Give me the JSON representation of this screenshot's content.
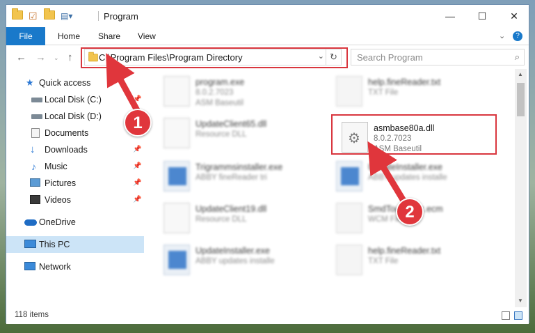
{
  "window": {
    "title": "Program",
    "controls": {
      "minimize": "—",
      "maximize": "☐",
      "close": "✕"
    }
  },
  "ribbon": {
    "tabs": [
      "File",
      "Home",
      "Share",
      "View"
    ],
    "expand_icon": "chevron-down",
    "help_icon": "?"
  },
  "address": {
    "path": "C:\\Program Files\\Program Directory",
    "search_placeholder": "Search Program"
  },
  "nav": {
    "items": [
      {
        "label": "Quick access",
        "icon": "star-icon",
        "pinned": false
      },
      {
        "label": "Local Disk (C:)",
        "icon": "drive-icon",
        "pinned": true
      },
      {
        "label": "Local Disk (D:)",
        "icon": "drive-icon",
        "pinned": false
      },
      {
        "label": "Documents",
        "icon": "documents-icon",
        "pinned": true
      },
      {
        "label": "Downloads",
        "icon": "download-icon",
        "pinned": true
      },
      {
        "label": "Music",
        "icon": "music-icon",
        "pinned": true
      },
      {
        "label": "Pictures",
        "icon": "pictures-icon",
        "pinned": true
      },
      {
        "label": "Videos",
        "icon": "videos-icon",
        "pinned": true
      },
      {
        "label": "OneDrive",
        "icon": "cloud-icon",
        "pinned": false
      },
      {
        "label": "This PC",
        "icon": "computer-icon",
        "pinned": false,
        "selected": true
      },
      {
        "label": "Network",
        "icon": "network-icon",
        "pinned": false
      }
    ]
  },
  "files": [
    {
      "name": "program.exe",
      "line1": "8.0.2.7023",
      "line2": "ASM Baseutil",
      "blurred": true
    },
    {
      "name": "help.fineReader.txt",
      "line1": "TXT File",
      "line2": "",
      "blurred": true
    },
    {
      "name": "UpdateClient65.dll",
      "line1": "Resource DLL",
      "line2": "",
      "blurred": true
    },
    {
      "name": "asmbase80a.dll",
      "line1": "8.0.2.7023",
      "line2": "ASM Baseutil",
      "blurred": false
    },
    {
      "name": "Trigrammsinstaller.exe",
      "line1": "ABBY fineReader tri",
      "line2": "",
      "blurred": true
    },
    {
      "name": "UpdateInstaller.exe",
      "line1": "ABBY updates installe",
      "line2": "",
      "blurred": true
    },
    {
      "name": "UpdateClient19.dll",
      "line1": "Resource DLL",
      "line2": "",
      "blurred": true
    },
    {
      "name": "SmdTouchEnc.ecm",
      "line1": "WCM File",
      "line2": "",
      "blurred": true
    },
    {
      "name": "UpdateInstaller.exe",
      "line1": "ABBY updates installe",
      "line2": "",
      "blurred": true
    },
    {
      "name": "help.fineReader.txt",
      "line1": "TXT File",
      "line2": "",
      "blurred": true
    }
  ],
  "status": {
    "count": "118 items"
  },
  "callouts": [
    "1",
    "2"
  ],
  "colors": {
    "accent": "#1979ca",
    "highlight": "#d9363e",
    "selected": "#cce4f7"
  }
}
